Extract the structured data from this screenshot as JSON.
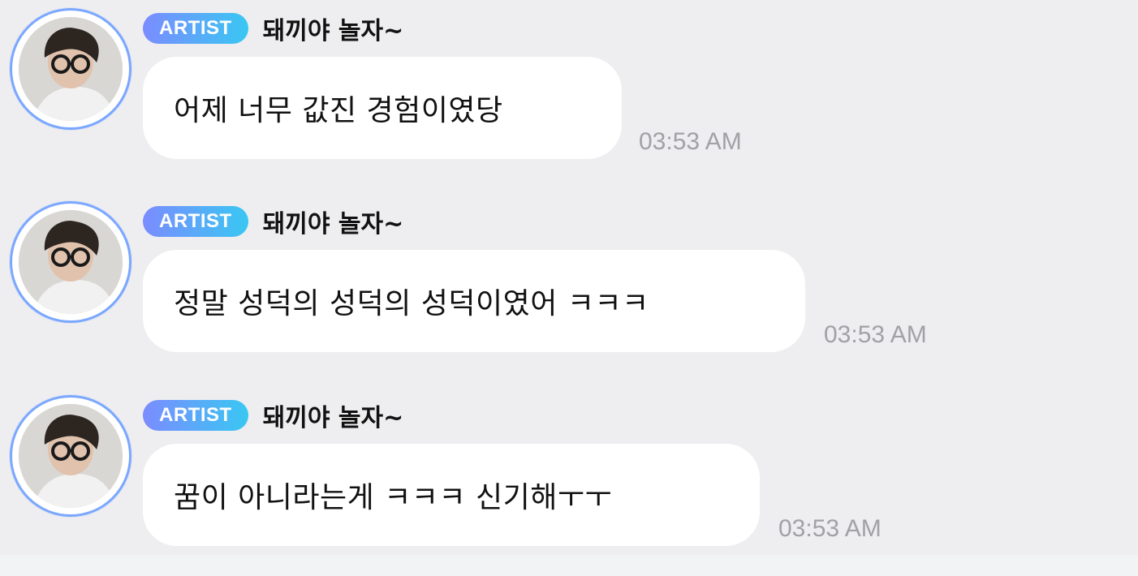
{
  "messages": [
    {
      "badge": "ARTIST",
      "author": "돼끼야 놀자~",
      "text": "어제 너무 값진 경험이였당",
      "time": "03:53 AM"
    },
    {
      "badge": "ARTIST",
      "author": "돼끼야 놀자~",
      "text": "정말 성덕의 성덕의 성덕이였어 ㅋㅋㅋ",
      "time": "03:53 AM"
    },
    {
      "badge": "ARTIST",
      "author": "돼끼야 놀자~",
      "text": "꿈이 아니라는게 ㅋㅋㅋ 신기해ㅜㅜ",
      "time": "03:53 AM"
    }
  ],
  "colors": {
    "background": "#eeeef0",
    "bubble": "#ffffff",
    "badge_gradient_start": "#7b8cff",
    "badge_gradient_end": "#39c7f2",
    "avatar_ring": "#7aa7ff",
    "timestamp": "#a1a1a6"
  },
  "icons": {
    "avatar": "profile-photo"
  }
}
